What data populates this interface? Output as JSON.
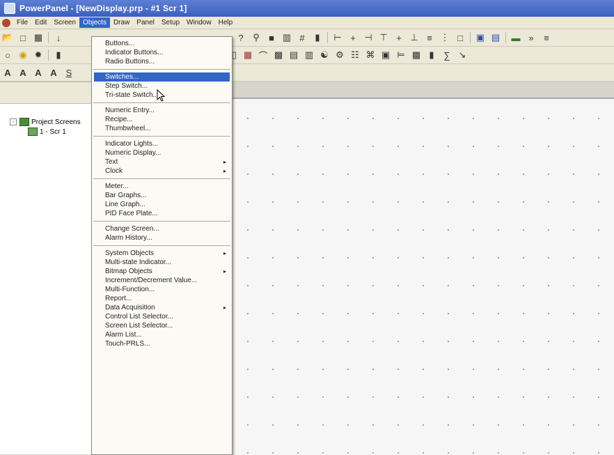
{
  "window": {
    "title": "PowerPanel - [NewDisplay.prp - #1 Scr 1]"
  },
  "menubar": {
    "items": [
      "File",
      "Edit",
      "Screen",
      "Objects",
      "Draw",
      "Panel",
      "Setup",
      "Window",
      "Help"
    ],
    "active": "Objects"
  },
  "tree": {
    "root": "Project Screens",
    "child": "1 - Scr 1",
    "expanded_symbol": "-"
  },
  "objects_menu": {
    "group1": [
      "Buttons...",
      "Indicator Buttons...",
      "Radio Buttons..."
    ],
    "group2": [
      "Switches...",
      "Step Switch...",
      "Tri-state Switch..."
    ],
    "highlighted": "Switches...",
    "group3": [
      "Numeric Entry...",
      "Recipe...",
      "Thumbwheel..."
    ],
    "group4": [
      {
        "label": "Indicator Lights...",
        "submenu": false
      },
      {
        "label": "Numeric Display...",
        "submenu": false
      },
      {
        "label": "Text",
        "submenu": true
      },
      {
        "label": "Clock",
        "submenu": true
      }
    ],
    "group5": [
      "Meter...",
      "Bar Graphs...",
      "Line Graph...",
      "PID Face Plate..."
    ],
    "group6": [
      "Change Screen...",
      "Alarm History..."
    ],
    "group7": [
      {
        "label": "System Objects",
        "submenu": true
      },
      {
        "label": "Multi-state Indicator...",
        "submenu": false
      },
      {
        "label": "Bitmap Objects",
        "submenu": true
      },
      {
        "label": "Increment/Decrement Value...",
        "submenu": false
      },
      {
        "label": "Multi-Function...",
        "submenu": false
      },
      {
        "label": "Report...",
        "submenu": false
      },
      {
        "label": "Data Acquisition",
        "submenu": true
      },
      {
        "label": "Control List Selector...",
        "submenu": false
      },
      {
        "label": "Screen List Selector...",
        "submenu": false
      },
      {
        "label": "Alarm List...",
        "submenu": false
      },
      {
        "label": "Touch-PRLS...",
        "submenu": false
      }
    ],
    "submenu_arrow": "▸"
  },
  "toolbar_text": {
    "font_bold": "A",
    "grid": "#"
  },
  "icons": [
    "app-icon",
    "new-icon",
    "open-icon",
    "save-icon",
    "zoom-icon",
    "grid-icon",
    "align-icon",
    "mouse-cursor-icon"
  ]
}
